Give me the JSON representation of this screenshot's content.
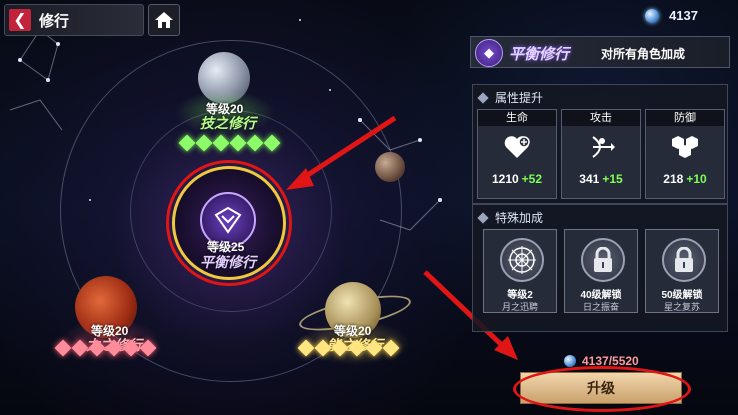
{
  "header": {
    "back_label": "修行",
    "currency": "4137"
  },
  "nodes": {
    "skill": {
      "level": "等级20",
      "name": "技之修行",
      "star_color": "#8dfc69"
    },
    "balance": {
      "level": "等级25",
      "name": "平衡修行"
    },
    "power": {
      "level": "等级20",
      "name": "力之修行",
      "star_color": "#ff8c9a"
    },
    "energy": {
      "level": "等级20",
      "name": "能之修行",
      "star_color": "#ffe680"
    }
  },
  "panel": {
    "title": "平衡修行",
    "subtitle": "对所有角色加成",
    "attr_section_title": "属性提升",
    "attributes": [
      {
        "label": "生命",
        "value": "1210",
        "plus": "+52",
        "icon": "heart-plus-icon"
      },
      {
        "label": "攻击",
        "value": "341",
        "plus": "+15",
        "icon": "archer-icon"
      },
      {
        "label": "防御",
        "value": "218",
        "plus": "+10",
        "icon": "hexagon-shield-icon"
      }
    ],
    "special_section_title": "特殊加成",
    "bonuses": [
      {
        "main": "等级2",
        "sub": "月之迅聘",
        "locked": false,
        "icon": "compass-rune-icon"
      },
      {
        "main": "40级解锁",
        "sub": "日之振奋",
        "locked": true,
        "icon": "lock-icon"
      },
      {
        "main": "50级解锁",
        "sub": "星之复苏",
        "locked": true,
        "icon": "lock-icon"
      }
    ],
    "cost": "4137/5520",
    "upgrade_label": "升级"
  }
}
